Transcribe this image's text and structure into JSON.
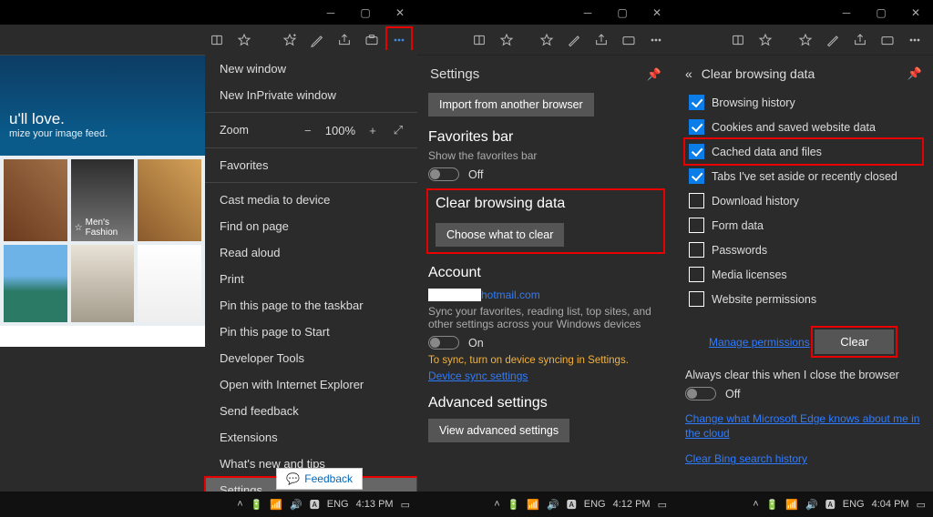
{
  "pane1": {
    "hero_title": "u'll love.",
    "hero_sub": "mize your image feed.",
    "tile_caption": "Men's Fashion",
    "ctx": {
      "new_window": "New window",
      "new_inprivate": "New InPrivate window",
      "zoom_label": "Zoom",
      "zoom_value": "100%",
      "favorites": "Favorites",
      "cast": "Cast media to device",
      "find": "Find on page",
      "read_aloud": "Read aloud",
      "print": "Print",
      "pin_taskbar": "Pin this page to the taskbar",
      "pin_start": "Pin this page to Start",
      "devtools": "Developer Tools",
      "open_ie": "Open with Internet Explorer",
      "feedback": "Send feedback",
      "extensions": "Extensions",
      "whatsnew": "What's new and tips",
      "settings": "Settings"
    },
    "feedback_button": "Feedback",
    "taskbar": {
      "lang": "ENG",
      "time": "4:13 PM"
    }
  },
  "pane2": {
    "title": "Settings",
    "import_btn": "Import from another browser",
    "fav_h": "Favorites bar",
    "fav_sub": "Show the favorites bar",
    "fav_state": "Off",
    "cbd_h": "Clear browsing data",
    "cbd_btn": "Choose what to clear",
    "acct_h": "Account",
    "acct_email": "hotmail.com",
    "acct_sub": "Sync your favorites, reading list, top sites, and other settings across your Windows devices",
    "acct_state": "On",
    "sync_warn": "To sync, turn on device syncing in Settings.",
    "sync_link": "Device sync settings",
    "adv_h": "Advanced settings",
    "adv_btn": "View advanced settings",
    "taskbar": {
      "lang": "ENG",
      "time": "4:12 PM"
    }
  },
  "pane3": {
    "title": "Clear browsing data",
    "items": [
      {
        "label": "Browsing history",
        "checked": true
      },
      {
        "label": "Cookies and saved website data",
        "checked": true
      },
      {
        "label": "Cached data and files",
        "checked": true,
        "boxed": true
      },
      {
        "label": "Tabs I've set aside or recently closed",
        "checked": true
      },
      {
        "label": "Download history",
        "checked": false
      },
      {
        "label": "Form data",
        "checked": false
      },
      {
        "label": "Passwords",
        "checked": false
      },
      {
        "label": "Media licenses",
        "checked": false
      },
      {
        "label": "Website permissions",
        "checked": false
      }
    ],
    "manage_perm": "Manage permissions",
    "clear_btn": "Clear",
    "auto_clear": "Always clear this when I close the browser",
    "auto_state": "Off",
    "link1": "Change what Microsoft Edge knows about me in the cloud",
    "link2": "Clear Bing search history",
    "taskbar": {
      "lang": "ENG",
      "time": "4:04 PM"
    }
  }
}
